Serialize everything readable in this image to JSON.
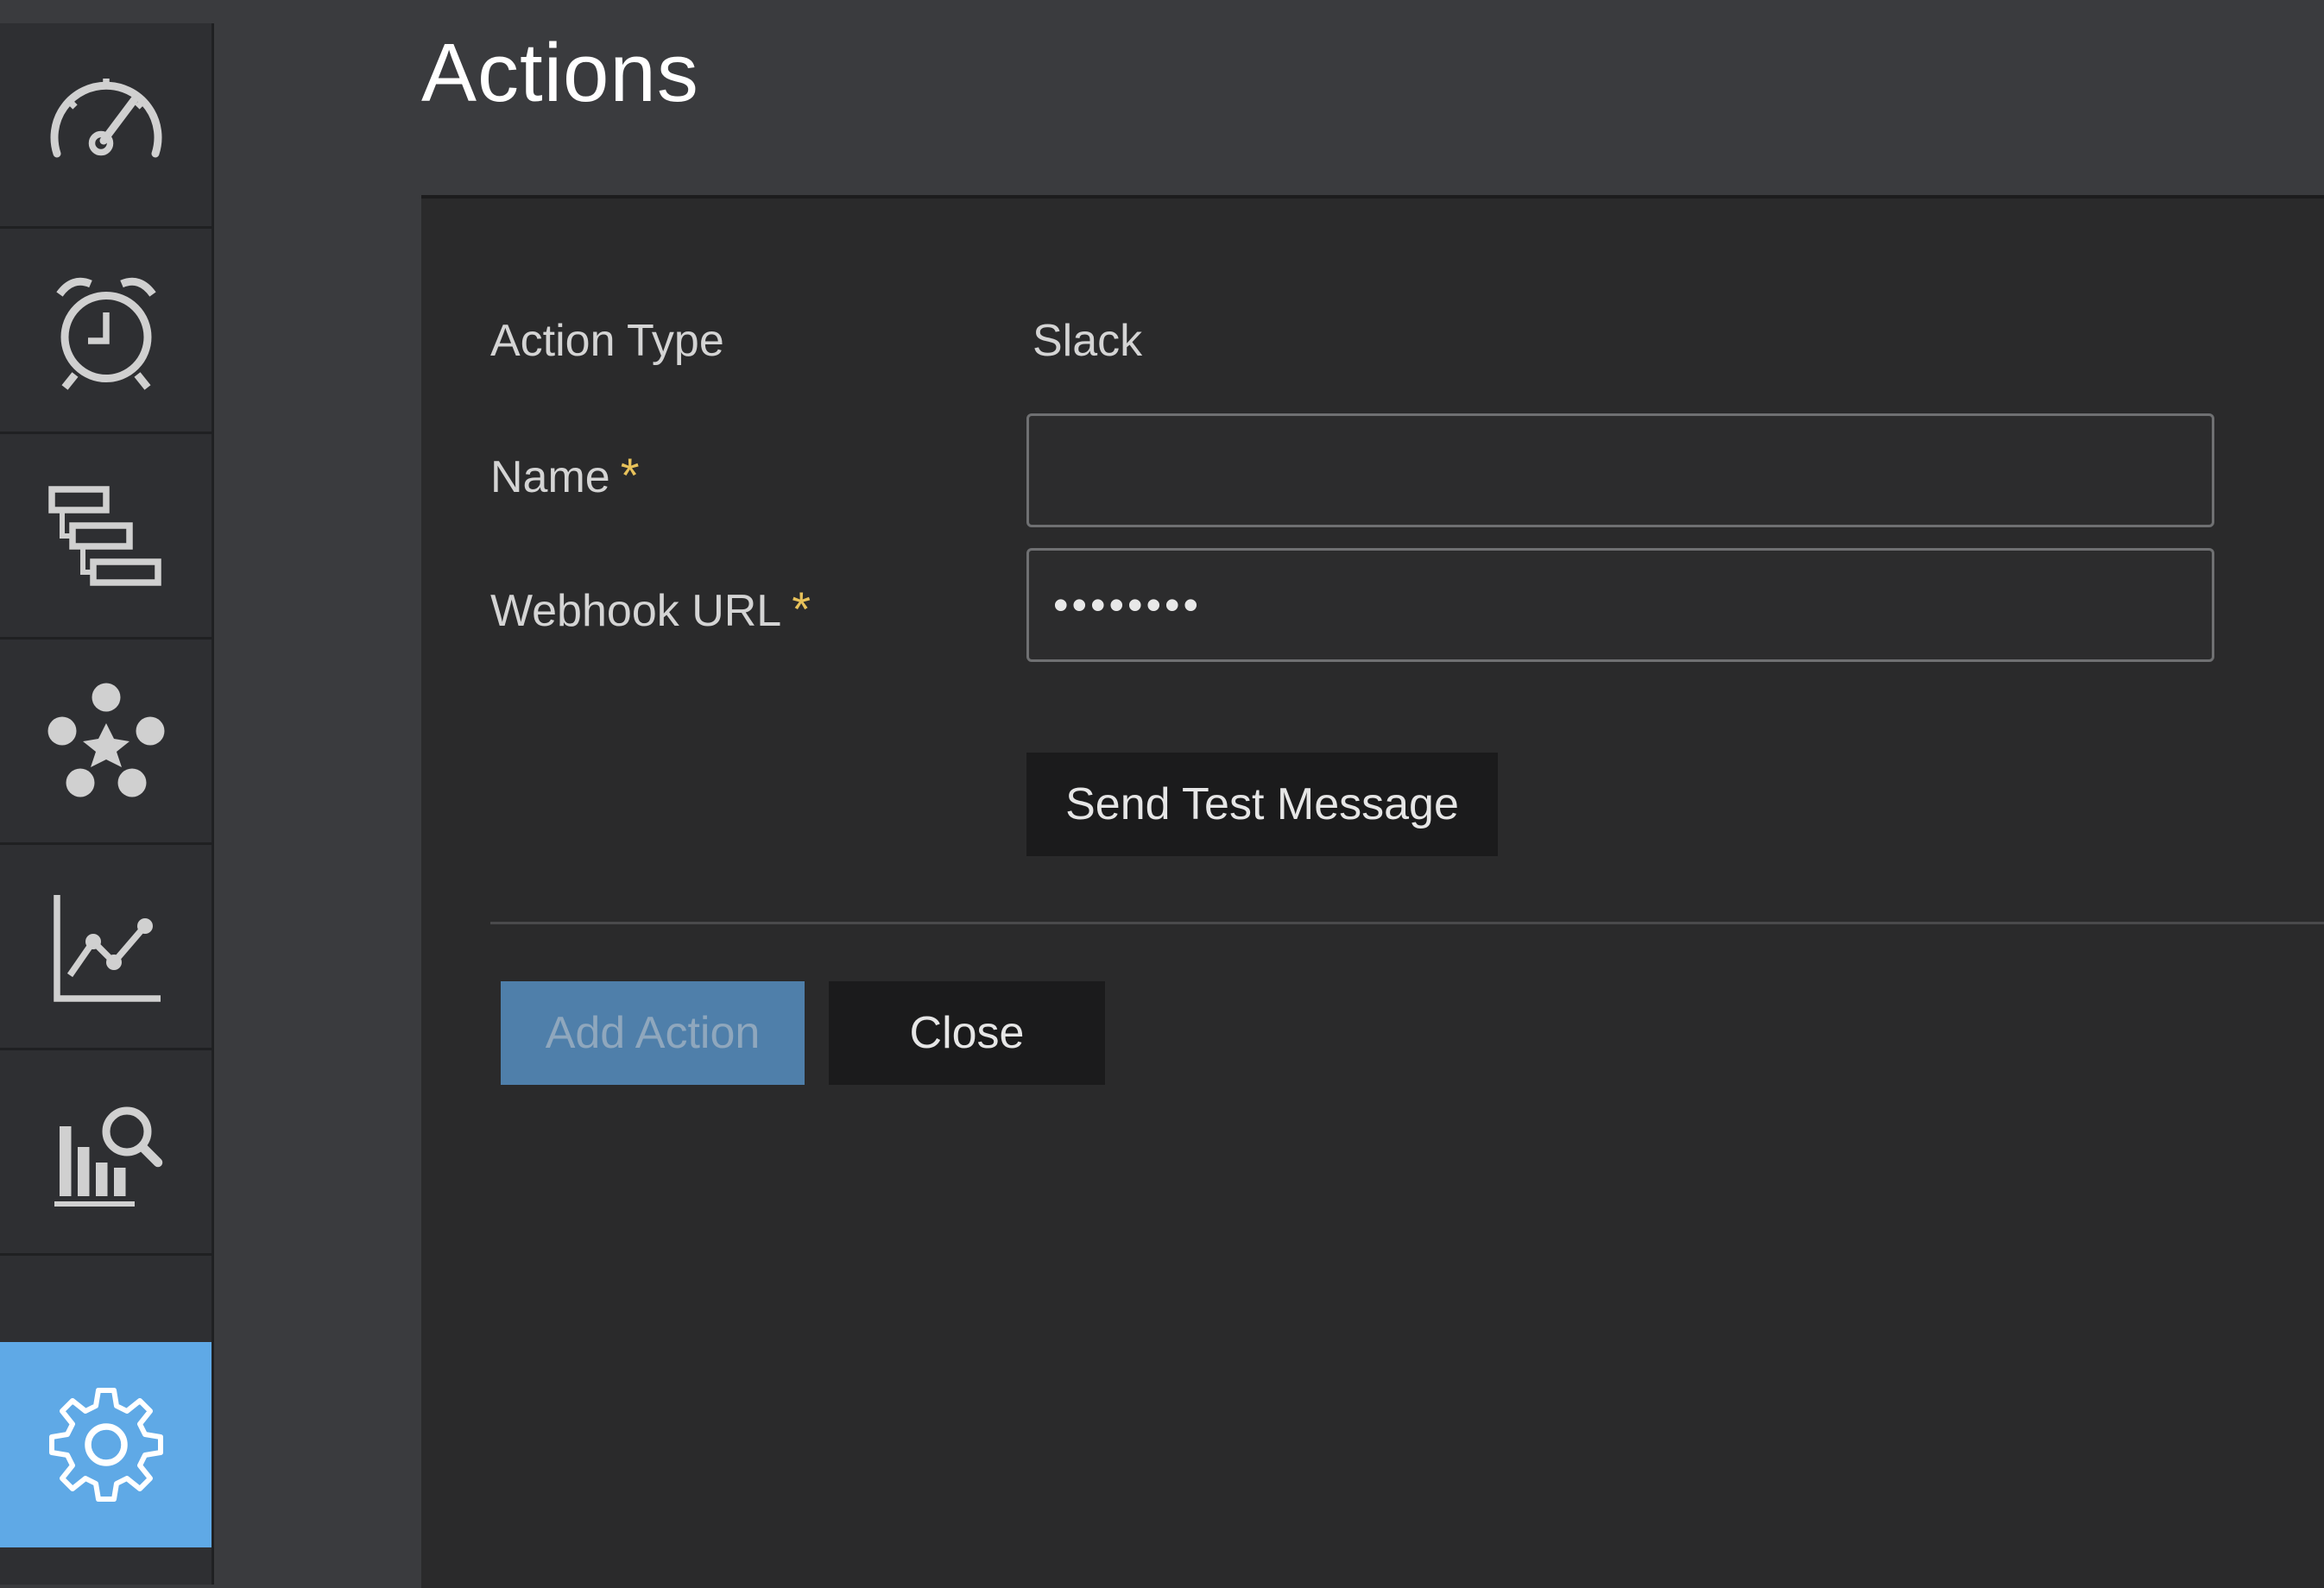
{
  "page": {
    "title": "Actions"
  },
  "sidebar": {
    "items": [
      {
        "icon": "speedometer-icon",
        "active": false
      },
      {
        "icon": "alarm-clock-icon",
        "active": false
      },
      {
        "icon": "hierarchy-icon",
        "active": false
      },
      {
        "icon": "network-icon",
        "active": false
      },
      {
        "icon": "line-chart-icon",
        "active": false
      },
      {
        "icon": "bar-chart-search-icon",
        "active": false
      },
      {
        "icon": "gear-icon",
        "active": true
      }
    ],
    "active_color": "#5fa9e6"
  },
  "form": {
    "action_type_label": "Action Type",
    "action_type_value": "Slack",
    "name_label": "Name",
    "name_value": "",
    "required_marker": "*",
    "webhook_label": "Webhook URL",
    "webhook_value": "••••••••"
  },
  "buttons": {
    "send_test": "Send Test Message",
    "add_action": "Add Action",
    "close": "Close"
  },
  "colors": {
    "required": "#e7c15a",
    "primary_button": "#4f7faa"
  }
}
